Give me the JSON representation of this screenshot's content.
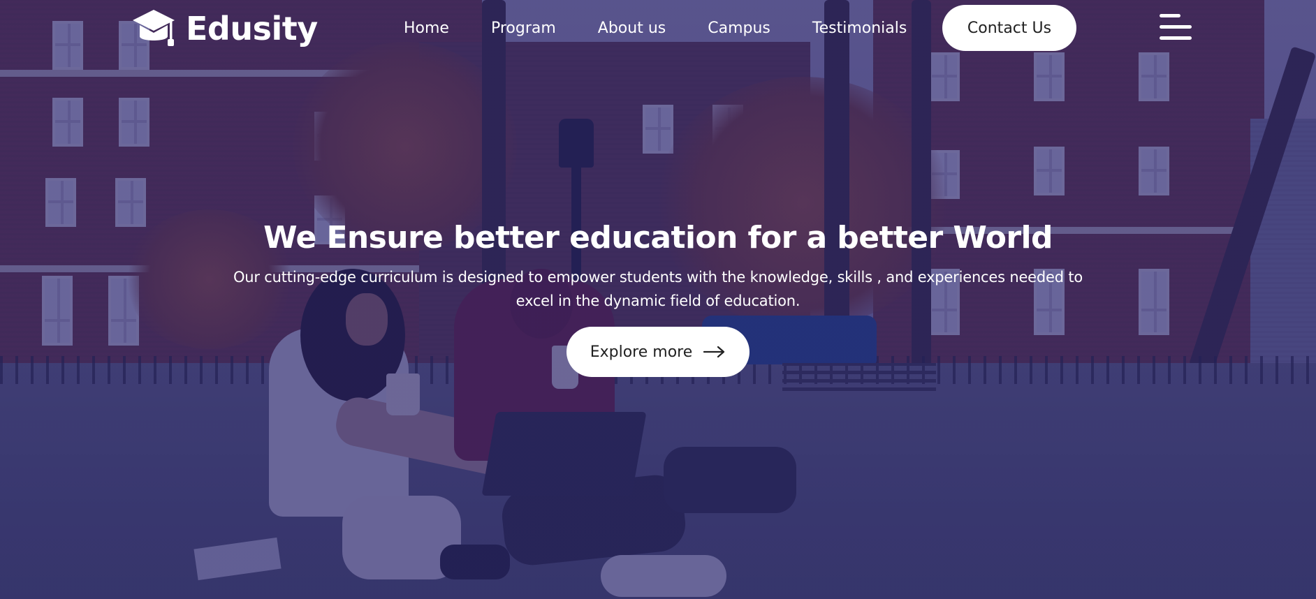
{
  "brand": {
    "name": "Edusity",
    "logo_icon": "graduation-cap-icon"
  },
  "nav": {
    "items": [
      {
        "label": "Home"
      },
      {
        "label": "Program"
      },
      {
        "label": "About us"
      },
      {
        "label": "Campus"
      },
      {
        "label": "Testimonials"
      }
    ],
    "contact_label": "Contact Us",
    "menu_icon": "hamburger-menu-icon"
  },
  "hero": {
    "title": "We Ensure better education for a better World",
    "subtitle": "Our cutting-edge curriculum is designed to empower students with the knowledge, skills , and experiences needed to excel in the dynamic field of education.",
    "cta_label": "Explore more",
    "cta_icon": "arrow-right-icon"
  },
  "colors": {
    "overlay": "#26226e",
    "button_bg": "#ffffff",
    "button_text": "#212121",
    "nav_text": "#ffffff"
  }
}
